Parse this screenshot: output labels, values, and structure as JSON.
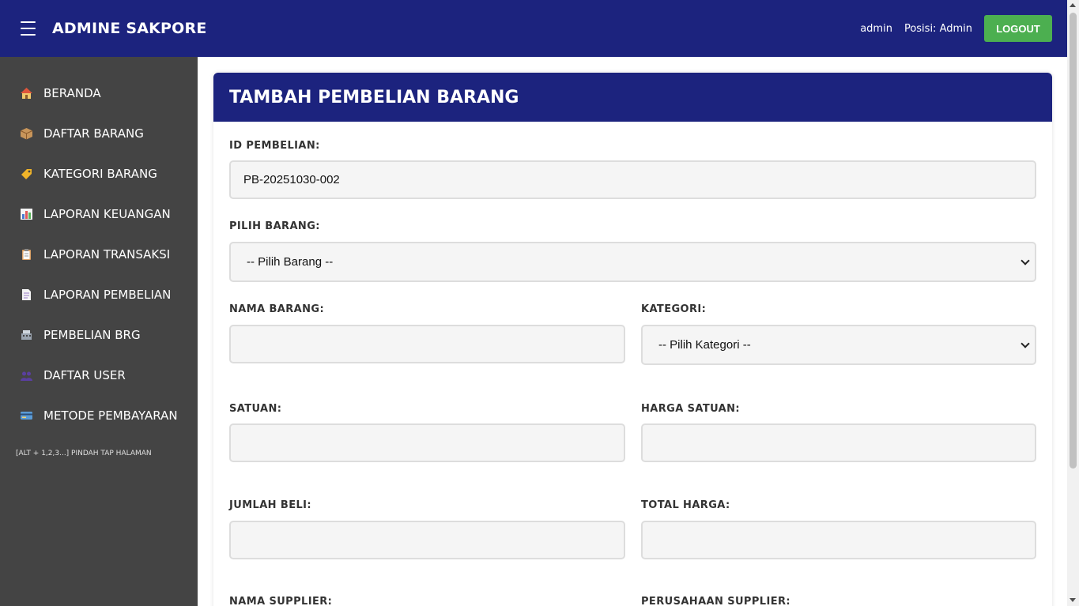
{
  "header": {
    "title": "ADMINE SAKPORE",
    "user": "admin",
    "role": "Posisi: Admin",
    "logout_label": "LOGOUT"
  },
  "sidebar": {
    "items": [
      {
        "label": "BERANDA",
        "icon": "house-icon"
      },
      {
        "label": "DAFTAR BARANG",
        "icon": "package-icon"
      },
      {
        "label": "KATEGORI BARANG",
        "icon": "tag-icon"
      },
      {
        "label": "LAPORAN KEUANGAN",
        "icon": "bar-chart-icon"
      },
      {
        "label": "LAPORAN TRANSAKSI",
        "icon": "clipboard-icon"
      },
      {
        "label": "LAPORAN PEMBELIAN",
        "icon": "document-icon"
      },
      {
        "label": "PEMBELIAN BRG",
        "icon": "cash-register-icon"
      },
      {
        "label": "DAFTAR USER",
        "icon": "users-icon"
      },
      {
        "label": "METODE PEMBAYARAN",
        "icon": "credit-card-icon"
      }
    ],
    "shortcut_hint": "[ALT + 1,2,3...] PINDAH TAP HALAMAN"
  },
  "form": {
    "title": "TAMBAH PEMBELIAN BARANG",
    "id_label": "ID PEMBELIAN:",
    "id_value": "PB-20251030-002",
    "barang_label": "PILIH BARANG:",
    "barang_selected": "-- Pilih Barang --",
    "nama_label": "NAMA BARANG:",
    "nama_value": "",
    "kategori_label": "KATEGORI:",
    "kategori_selected": "-- Pilih Kategori --",
    "satuan_label": "SATUAN:",
    "satuan_value": "",
    "harga_label": "HARGA SATUAN:",
    "harga_value": "",
    "jumlah_label": "JUMLAH BELI:",
    "jumlah_value": "",
    "total_label": "TOTAL HARGA:",
    "total_value": "",
    "supplier_label": "NAMA SUPPLIER:",
    "perusahaan_label": "PERUSAHAAN SUPPLIER:"
  },
  "colors": {
    "primary": "#1c237e",
    "sidebar": "#444444",
    "logout": "#4caf50"
  }
}
